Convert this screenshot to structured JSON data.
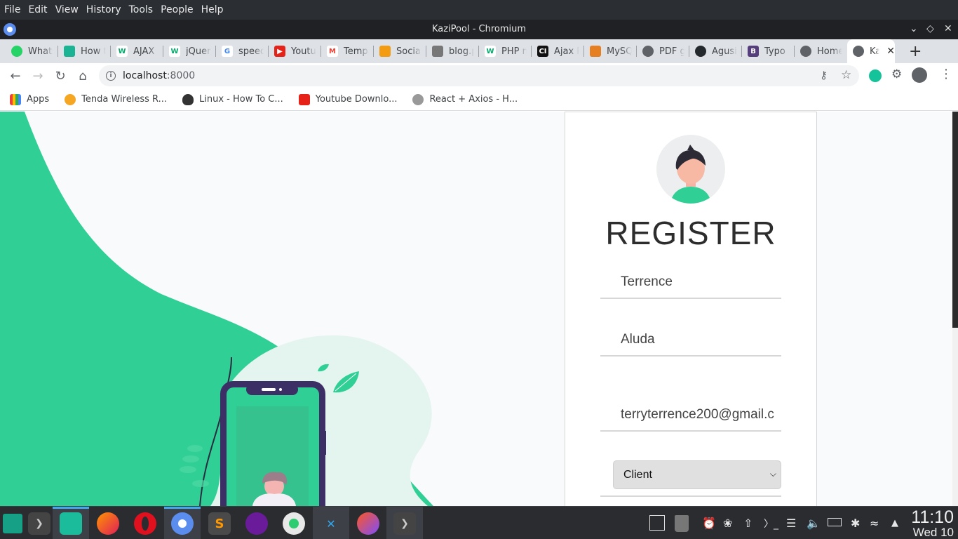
{
  "menubar": {
    "items": [
      "File",
      "Edit",
      "View",
      "History",
      "Tools",
      "People",
      "Help"
    ]
  },
  "window": {
    "title": "KaziPool - Chromium"
  },
  "tabs": [
    {
      "label": "WhatsApp",
      "icon": "whatsapp-icon",
      "color": "#25d366"
    },
    {
      "label": "How to",
      "icon": "stackshare-icon",
      "color": "#1ab394"
    },
    {
      "label": "AJAX",
      "icon": "w3schools-icon",
      "color": "#04aa6d"
    },
    {
      "label": "jQuery",
      "icon": "w3schools-icon",
      "color": "#04aa6d"
    },
    {
      "label": "speed",
      "icon": "google-icon",
      "color": "#4285f4"
    },
    {
      "label": "Youtube",
      "icon": "youtube-icon",
      "color": "#e62117"
    },
    {
      "label": "Temp",
      "icon": "gmail-icon",
      "color": "#ea4335"
    },
    {
      "label": "Social",
      "icon": "social-icon",
      "color": "#f39c12"
    },
    {
      "label": "blog.p",
      "icon": "doc-icon",
      "color": "#777777"
    },
    {
      "label": "PHP n",
      "icon": "w3schools-icon",
      "color": "#04aa6d"
    },
    {
      "label": "Ajax P",
      "icon": "codeigniter-icon",
      "color": "#111111"
    },
    {
      "label": "MySQ",
      "icon": "mysql-icon",
      "color": "#e67e22"
    },
    {
      "label": "PDF g",
      "icon": "globe-icon",
      "color": "#5f6368"
    },
    {
      "label": "Agusi",
      "icon": "github-icon",
      "color": "#24292e"
    },
    {
      "label": "Typo",
      "icon": "bootstrap-icon",
      "color": "#563d7c"
    },
    {
      "label": "Home",
      "icon": "globe-icon",
      "color": "#5f6368"
    },
    {
      "label": "Ka",
      "icon": "globe-icon",
      "color": "#5f6368",
      "active": true
    }
  ],
  "toolbar": {
    "url_host": "localhost",
    "url_port": ":8000"
  },
  "bookmarks": [
    {
      "label": "Apps",
      "icon": "apps-grid-icon",
      "color": "#4285f4"
    },
    {
      "label": "Tenda Wireless R...",
      "icon": "tenda-icon",
      "color": "#f5a623"
    },
    {
      "label": "Linux - How To C...",
      "icon": "linux-icon",
      "color": "#333333"
    },
    {
      "label": "Youtube Downlo...",
      "icon": "youtube-icon",
      "color": "#e62117"
    },
    {
      "label": "React + Axios - H...",
      "icon": "person-icon",
      "color": "#999999"
    }
  ],
  "form": {
    "title": "REGISTER",
    "first_name": "Terrence",
    "last_name": "Aluda",
    "email": "terryterrence200@gmail.c",
    "role": "Client"
  },
  "clock": {
    "time": "11:10",
    "date": "Wed 10"
  },
  "colors": {
    "brand_green": "#2fcf95",
    "active_tab": "#ffffff",
    "taskbar": "#2a2c30"
  }
}
